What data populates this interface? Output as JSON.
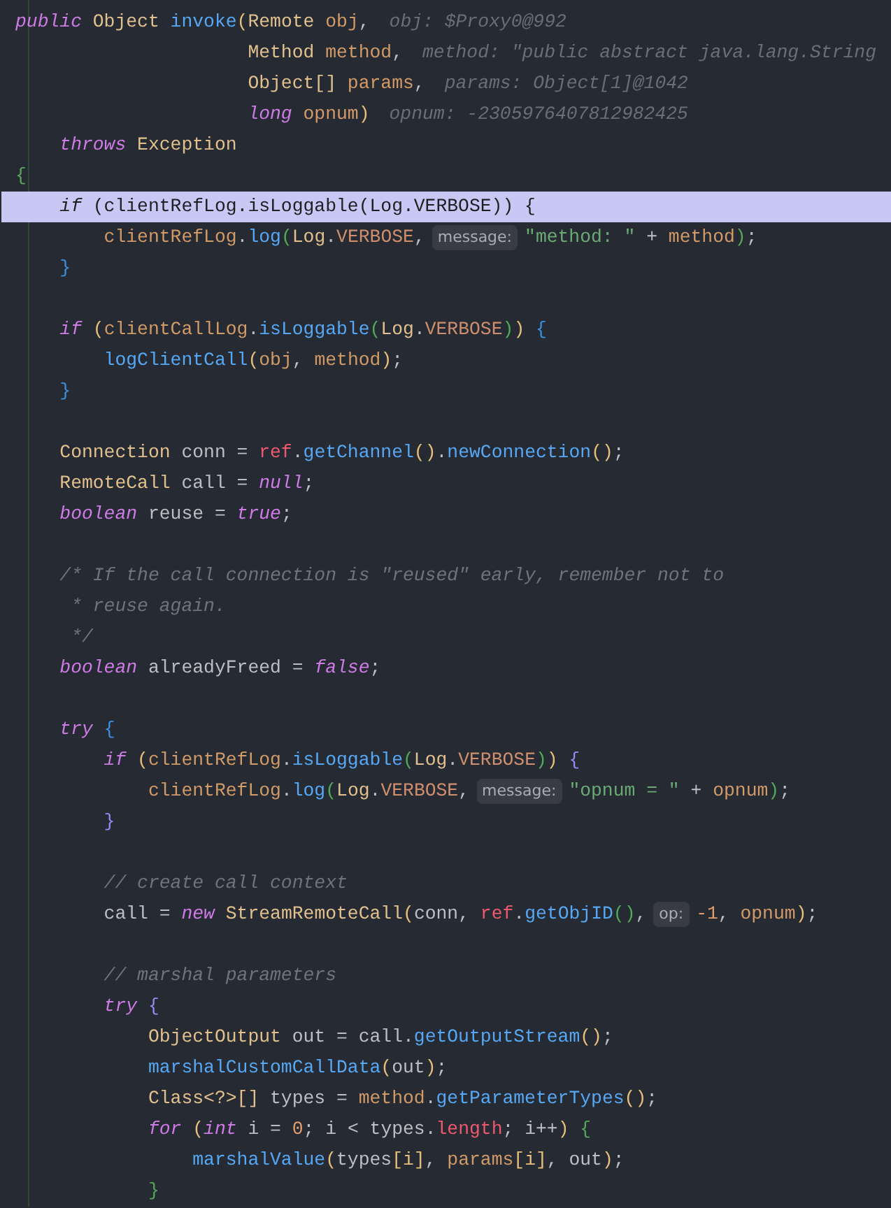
{
  "lines": [
    {
      "highlighted": false,
      "tokens": [
        {
          "t": "public",
          "kind": "kw"
        },
        {
          "t": " Object",
          "kind": "type"
        },
        {
          "t": " invoke",
          "kind": "method"
        },
        {
          "t": "(",
          "kind": "gold"
        },
        {
          "t": "Remote",
          "kind": "type"
        },
        {
          "t": " obj",
          "kind": "param"
        },
        {
          "t": ",",
          "kind": "plain"
        },
        {
          "t": "obj: $Proxy0@992",
          "kind": "debug"
        }
      ]
    },
    {
      "highlighted": false,
      "tokens": [
        {
          "t": "                     Method",
          "kind": "type"
        },
        {
          "t": " method",
          "kind": "param"
        },
        {
          "t": ",",
          "kind": "plain"
        },
        {
          "t": "method: \"public abstract java.lang.String",
          "kind": "debug"
        }
      ]
    },
    {
      "highlighted": false,
      "tokens": [
        {
          "t": "                     Object[]",
          "kind": "type"
        },
        {
          "t": " params",
          "kind": "param"
        },
        {
          "t": ",",
          "kind": "plain"
        },
        {
          "t": "params: Object[1]@1042",
          "kind": "debug"
        }
      ]
    },
    {
      "highlighted": false,
      "tokens": [
        {
          "t": "                     long",
          "kind": "kw"
        },
        {
          "t": " opnum",
          "kind": "param"
        },
        {
          "t": ")",
          "kind": "gold"
        },
        {
          "t": "opnum: -2305976407812982425",
          "kind": "debug"
        }
      ]
    },
    {
      "highlighted": false,
      "tokens": [
        {
          "t": "    throws",
          "kind": "kw"
        },
        {
          "t": " Exception",
          "kind": "type"
        }
      ]
    },
    {
      "highlighted": false,
      "tokens": [
        {
          "t": "{",
          "kind": "green"
        }
      ]
    },
    {
      "highlighted": true,
      "tokens": [
        {
          "t": "    if",
          "kind": "kw"
        },
        {
          "t": " (clientRefLog.isLoggable(Log.VERBOSE)) {",
          "kind": "plain"
        }
      ]
    },
    {
      "highlighted": false,
      "tokens": [
        {
          "t": "        clientRefLog",
          "kind": "param"
        },
        {
          "t": ".",
          "kind": "plain"
        },
        {
          "t": "log",
          "kind": "method"
        },
        {
          "t": "(",
          "kind": "green"
        },
        {
          "t": "Log",
          "kind": "type"
        },
        {
          "t": ".",
          "kind": "plain"
        },
        {
          "t": "VERBOSE",
          "kind": "const"
        },
        {
          "t": ",",
          "kind": "plain"
        },
        {
          "t": "message:",
          "kind": "inlay"
        },
        {
          "t": "\"method: \"",
          "kind": "string"
        },
        {
          "t": " + ",
          "kind": "plain"
        },
        {
          "t": "method",
          "kind": "param"
        },
        {
          "t": ")",
          "kind": "green"
        },
        {
          "t": ";",
          "kind": "plain"
        }
      ]
    },
    {
      "highlighted": false,
      "tokens": [
        {
          "t": "    }",
          "kind": "blue"
        }
      ]
    },
    {
      "highlighted": false
    },
    {
      "highlighted": false,
      "tokens": [
        {
          "t": "    if",
          "kind": "kw"
        },
        {
          "t": " (",
          "kind": "gold"
        },
        {
          "t": "clientCallLog",
          "kind": "param"
        },
        {
          "t": ".",
          "kind": "plain"
        },
        {
          "t": "isLoggable",
          "kind": "method"
        },
        {
          "t": "(",
          "kind": "green"
        },
        {
          "t": "Log",
          "kind": "type"
        },
        {
          "t": ".",
          "kind": "plain"
        },
        {
          "t": "VERBOSE",
          "kind": "const"
        },
        {
          "t": ")",
          "kind": "green"
        },
        {
          "t": ")",
          "kind": "gold"
        },
        {
          "t": " {",
          "kind": "blue"
        }
      ]
    },
    {
      "highlighted": false,
      "tokens": [
        {
          "t": "        logClientCall",
          "kind": "method"
        },
        {
          "t": "(",
          "kind": "gold"
        },
        {
          "t": "obj",
          "kind": "param"
        },
        {
          "t": ", ",
          "kind": "plain"
        },
        {
          "t": "method",
          "kind": "param"
        },
        {
          "t": ")",
          "kind": "gold"
        },
        {
          "t": ";",
          "kind": "plain"
        }
      ]
    },
    {
      "highlighted": false,
      "tokens": [
        {
          "t": "    }",
          "kind": "blue"
        }
      ]
    },
    {
      "highlighted": false
    },
    {
      "highlighted": false,
      "tokens": [
        {
          "t": "    Connection",
          "kind": "type"
        },
        {
          "t": " conn = ",
          "kind": "plain"
        },
        {
          "t": "ref",
          "kind": "ref"
        },
        {
          "t": ".",
          "kind": "plain"
        },
        {
          "t": "getChannel",
          "kind": "method"
        },
        {
          "t": "()",
          "kind": "gold"
        },
        {
          "t": ".",
          "kind": "plain"
        },
        {
          "t": "newConnection",
          "kind": "method"
        },
        {
          "t": "()",
          "kind": "gold"
        },
        {
          "t": ";",
          "kind": "plain"
        }
      ]
    },
    {
      "highlighted": false,
      "tokens": [
        {
          "t": "    RemoteCall",
          "kind": "type"
        },
        {
          "t": " call = ",
          "kind": "plain"
        },
        {
          "t": "null",
          "kind": "kw"
        },
        {
          "t": ";",
          "kind": "plain"
        }
      ]
    },
    {
      "highlighted": false,
      "tokens": [
        {
          "t": "    boolean",
          "kind": "kw"
        },
        {
          "t": " reuse = ",
          "kind": "plain"
        },
        {
          "t": "true",
          "kind": "kw"
        },
        {
          "t": ";",
          "kind": "plain"
        }
      ]
    },
    {
      "highlighted": false
    },
    {
      "highlighted": false,
      "tokens": [
        {
          "t": "    /* If the call connection is \"reused\" early, remember not to",
          "kind": "comment"
        }
      ]
    },
    {
      "highlighted": false,
      "tokens": [
        {
          "t": "     * reuse again.",
          "kind": "comment"
        }
      ]
    },
    {
      "highlighted": false,
      "tokens": [
        {
          "t": "     */",
          "kind": "comment"
        }
      ]
    },
    {
      "highlighted": false,
      "tokens": [
        {
          "t": "    boolean",
          "kind": "kw"
        },
        {
          "t": " alreadyFreed = ",
          "kind": "plain"
        },
        {
          "t": "false",
          "kind": "kw"
        },
        {
          "t": ";",
          "kind": "plain"
        }
      ]
    },
    {
      "highlighted": false
    },
    {
      "highlighted": false,
      "tokens": [
        {
          "t": "    try",
          "kind": "kw"
        },
        {
          "t": " {",
          "kind": "blue"
        }
      ]
    },
    {
      "highlighted": false,
      "tokens": [
        {
          "t": "        if",
          "kind": "kw"
        },
        {
          "t": " (",
          "kind": "gold"
        },
        {
          "t": "clientRefLog",
          "kind": "param"
        },
        {
          "t": ".",
          "kind": "plain"
        },
        {
          "t": "isLoggable",
          "kind": "method"
        },
        {
          "t": "(",
          "kind": "green"
        },
        {
          "t": "Log",
          "kind": "type"
        },
        {
          "t": ".",
          "kind": "plain"
        },
        {
          "t": "VERBOSE",
          "kind": "const"
        },
        {
          "t": ")",
          "kind": "green"
        },
        {
          "t": ")",
          "kind": "gold"
        },
        {
          "t": " {",
          "kind": "purple"
        }
      ]
    },
    {
      "highlighted": false,
      "tokens": [
        {
          "t": "            clientRefLog",
          "kind": "param"
        },
        {
          "t": ".",
          "kind": "plain"
        },
        {
          "t": "log",
          "kind": "method"
        },
        {
          "t": "(",
          "kind": "green"
        },
        {
          "t": "Log",
          "kind": "type"
        },
        {
          "t": ".",
          "kind": "plain"
        },
        {
          "t": "VERBOSE",
          "kind": "const"
        },
        {
          "t": ",",
          "kind": "plain"
        },
        {
          "t": "message:",
          "kind": "inlay"
        },
        {
          "t": "\"opnum = \"",
          "kind": "string"
        },
        {
          "t": " + ",
          "kind": "plain"
        },
        {
          "t": "opnum",
          "kind": "param"
        },
        {
          "t": ")",
          "kind": "green"
        },
        {
          "t": ";",
          "kind": "plain"
        }
      ]
    },
    {
      "highlighted": false,
      "tokens": [
        {
          "t": "        }",
          "kind": "purple"
        }
      ]
    },
    {
      "highlighted": false
    },
    {
      "highlighted": false,
      "tokens": [
        {
          "t": "        // create call context",
          "kind": "comment"
        }
      ]
    },
    {
      "highlighted": false,
      "tokens": [
        {
          "t": "        call = ",
          "kind": "plain"
        },
        {
          "t": "new",
          "kind": "kw"
        },
        {
          "t": " StreamRemoteCall",
          "kind": "type"
        },
        {
          "t": "(",
          "kind": "gold"
        },
        {
          "t": "conn, ",
          "kind": "plain"
        },
        {
          "t": "ref",
          "kind": "ref"
        },
        {
          "t": ".",
          "kind": "plain"
        },
        {
          "t": "getObjID",
          "kind": "method"
        },
        {
          "t": "()",
          "kind": "green"
        },
        {
          "t": ",",
          "kind": "plain"
        },
        {
          "t": "op:",
          "kind": "inlay"
        },
        {
          "t": "-1",
          "kind": "number"
        },
        {
          "t": ", ",
          "kind": "plain"
        },
        {
          "t": "opnum",
          "kind": "param"
        },
        {
          "t": ")",
          "kind": "gold"
        },
        {
          "t": ";",
          "kind": "plain"
        }
      ]
    },
    {
      "highlighted": false
    },
    {
      "highlighted": false,
      "tokens": [
        {
          "t": "        // marshal parameters",
          "kind": "comment"
        }
      ]
    },
    {
      "highlighted": false,
      "tokens": [
        {
          "t": "        try",
          "kind": "kw"
        },
        {
          "t": " {",
          "kind": "purple"
        }
      ]
    },
    {
      "highlighted": false,
      "tokens": [
        {
          "t": "            ObjectOutput",
          "kind": "type"
        },
        {
          "t": " out = call.",
          "kind": "plain"
        },
        {
          "t": "getOutputStream",
          "kind": "method"
        },
        {
          "t": "()",
          "kind": "gold"
        },
        {
          "t": ";",
          "kind": "plain"
        }
      ]
    },
    {
      "highlighted": false,
      "tokens": [
        {
          "t": "            marshalCustomCallData",
          "kind": "method"
        },
        {
          "t": "(",
          "kind": "gold"
        },
        {
          "t": "out",
          "kind": "plain"
        },
        {
          "t": ")",
          "kind": "gold"
        },
        {
          "t": ";",
          "kind": "plain"
        }
      ]
    },
    {
      "highlighted": false,
      "tokens": [
        {
          "t": "            Class<?>[]",
          "kind": "type"
        },
        {
          "t": " types = ",
          "kind": "plain"
        },
        {
          "t": "method",
          "kind": "param"
        },
        {
          "t": ".",
          "kind": "plain"
        },
        {
          "t": "getParameterTypes",
          "kind": "method"
        },
        {
          "t": "()",
          "kind": "gold"
        },
        {
          "t": ";",
          "kind": "plain"
        }
      ]
    },
    {
      "highlighted": false,
      "tokens": [
        {
          "t": "            for",
          "kind": "kw"
        },
        {
          "t": " (",
          "kind": "gold"
        },
        {
          "t": "int",
          "kind": "kw"
        },
        {
          "t": " i = ",
          "kind": "plain"
        },
        {
          "t": "0",
          "kind": "number"
        },
        {
          "t": "; i < types.",
          "kind": "plain"
        },
        {
          "t": "length",
          "kind": "ref"
        },
        {
          "t": "; i++",
          "kind": "plain"
        },
        {
          "t": ")",
          "kind": "gold"
        },
        {
          "t": " {",
          "kind": "green"
        }
      ]
    },
    {
      "highlighted": false,
      "tokens": [
        {
          "t": "                marshalValue",
          "kind": "method"
        },
        {
          "t": "(",
          "kind": "gold"
        },
        {
          "t": "types",
          "kind": "plain"
        },
        {
          "t": "[i]",
          "kind": "gold"
        },
        {
          "t": ", ",
          "kind": "plain"
        },
        {
          "t": "params",
          "kind": "param"
        },
        {
          "t": "[i]",
          "kind": "gold"
        },
        {
          "t": ", out",
          "kind": "plain"
        },
        {
          "t": ")",
          "kind": "gold"
        },
        {
          "t": ";",
          "kind": "plain"
        }
      ]
    },
    {
      "highlighted": false,
      "tokens": [
        {
          "t": "            }",
          "kind": "green"
        }
      ]
    }
  ]
}
